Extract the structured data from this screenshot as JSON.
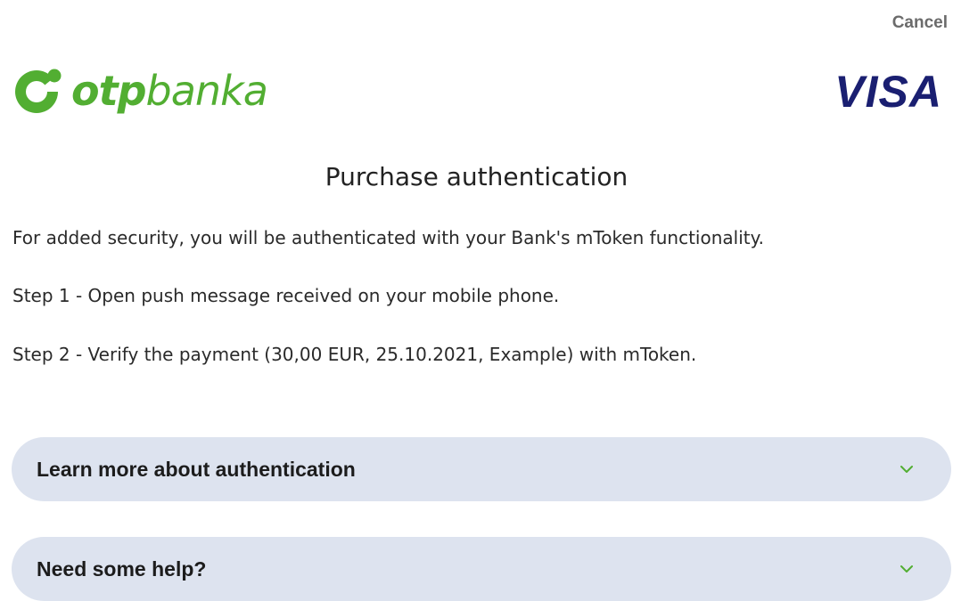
{
  "header": {
    "cancel_label": "Cancel",
    "bank_logo": {
      "wordmark_bold": "otp",
      "wordmark_light": "banka",
      "icon": "otp-swirl-icon",
      "color": "#52ae32"
    },
    "card_logo": {
      "text": "VISA",
      "color": "#1a1f71"
    }
  },
  "main": {
    "title": "Purchase authentication",
    "intro": "For added security, you will be authenticated with your Bank's mToken functionality.",
    "steps": [
      "Step 1 - Open push message received on your mobile phone.",
      "Step 2 - Verify the payment (30,00 EUR, 25.10.2021, Example) with mToken."
    ]
  },
  "accordions": [
    {
      "label": "Learn more about authentication",
      "icon": "chevron-down-icon",
      "expanded": false
    },
    {
      "label": "Need some help?",
      "icon": "chevron-down-icon",
      "expanded": false
    }
  ],
  "colors": {
    "accent_green": "#52ae32",
    "accordion_bg": "#dde3ef",
    "visa_blue": "#1a1f71"
  }
}
